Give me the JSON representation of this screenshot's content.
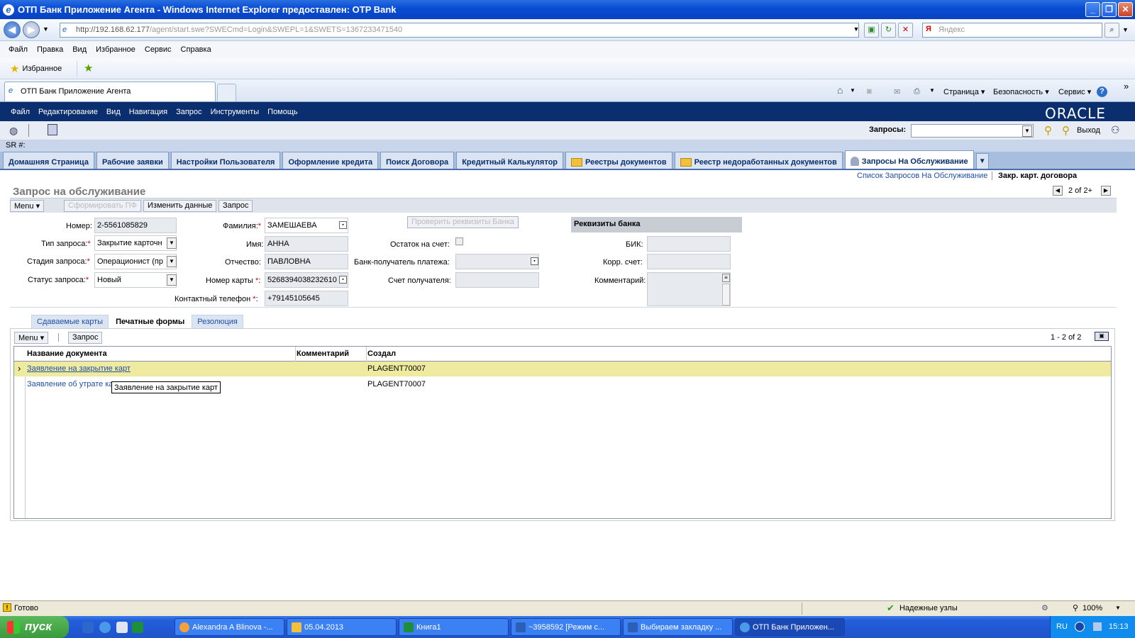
{
  "window": {
    "title": "ОТП Банк Приложение Агента - Windows Internet Explorer предоставлен: OTP Bank",
    "minimize": "_",
    "restore": "❐",
    "close": "✕"
  },
  "addressbar": {
    "url_main": "http://192.168.62.177",
    "url_rest": "/agent/start.swe?SWECmd=Login&SWEPL=1&SWETS=1367233471540",
    "search_placeholder": "Яндекс"
  },
  "ie_menu": [
    "Файл",
    "Правка",
    "Вид",
    "Избранное",
    "Сервис",
    "Справка"
  ],
  "favorites": {
    "label": "Избранное"
  },
  "ie_tab": {
    "label": "ОТП Банк Приложение Агента"
  },
  "ie_commands": {
    "page": "Страница ▾",
    "safety": "Безопасность ▾",
    "tools": "Сервис ▾",
    "more": "»"
  },
  "app_menu": [
    "Файл",
    "Редактирование",
    "Вид",
    "Навигация",
    "Запрос",
    "Инструменты",
    "Помощь"
  ],
  "brand": "ORACLE",
  "app_toolbar": {
    "queries_label": "Запросы:",
    "logout": "Выход"
  },
  "sr_label": "SR #:",
  "screen_tabs": [
    {
      "label": "Домашняя Страница"
    },
    {
      "label": "Рабочие заявки"
    },
    {
      "label": "Настройки Пользователя"
    },
    {
      "label": "Оформление кредита"
    },
    {
      "label": "Поиск Договора"
    },
    {
      "label": "Кредитный Калькулятор"
    },
    {
      "label": "Реестры документов"
    },
    {
      "label": "Реестр недоработанных документов"
    },
    {
      "label": "Запросы На Обслуживание"
    }
  ],
  "breadcrumb": {
    "link": "Список Запросов На Обслуживание",
    "current": "Закр. карт. договора"
  },
  "record_pager": "2 of 2+",
  "form": {
    "title": "Запрос на обслуживание",
    "toolbar": {
      "menu": "Menu ▾",
      "generate_pf": "Сформировать ПФ",
      "edit": "Изменить данные",
      "request": "Запрос"
    },
    "fields": {
      "number_label": "Номер:",
      "number": "2-5561085829",
      "type_label": "Тип запроса:",
      "type": "Закрытие карточн",
      "stage_label": "Стадия запроса:",
      "stage": "Операционист (пр",
      "status_label": "Статус запроса:",
      "status": "Новый",
      "surname_label": "Фамилия:",
      "surname": "ЗАМЕШАЕВА",
      "name_label": "Имя:",
      "name": "АННА",
      "patronymic_label": "Отчество:",
      "patronymic": "ПАВЛОВНА",
      "card_label": "Номер карты",
      "card": "5268394038232610",
      "phone_label": "Контактный телефон",
      "phone": "+79145105645",
      "check_bank_btn": "Проверить реквизиты Банка",
      "balance_label": "Остаток на счет:",
      "bank_recv_label": "Банк-получатель платежа:",
      "recv_account_label": "Счет получателя:",
      "bank_details_header": "Реквизиты банка",
      "bik_label": "БИК:",
      "corr_label": "Корр. счет:",
      "comment_label": "Комментарий:"
    }
  },
  "sub_tabs": [
    {
      "label": "Сдаваемые карты"
    },
    {
      "label": "Печатные формы"
    },
    {
      "label": "Резолюция"
    }
  ],
  "applet": {
    "menu": "Menu ▾",
    "request": "Запрос",
    "pager": "1 - 2 of 2",
    "columns": [
      "Название документа",
      "Комментарий",
      "Создал"
    ],
    "rows": [
      {
        "doc": "Заявление на закрытие карт",
        "comment": "",
        "created": "PLAGENT70007"
      },
      {
        "doc": "Заявление об утрате ка",
        "comment": "",
        "created": "PLAGENT70007"
      }
    ],
    "tooltip": "Заявление на закрытие карт"
  },
  "statusbar": {
    "ready": "Готово",
    "zone": "Надежные узлы",
    "zoom": "100%"
  },
  "taskbar": {
    "start": "пуск",
    "tasks": [
      {
        "label": "Alexandra A Blinova -..."
      },
      {
        "label": "05.04.2013"
      },
      {
        "label": "Книга1"
      },
      {
        "label": "~3958592 [Режим с..."
      },
      {
        "label": "Выбираем закладку ..."
      },
      {
        "label": "ОТП Банк Приложен..."
      }
    ],
    "lang": "RU",
    "clock": "15:13"
  }
}
